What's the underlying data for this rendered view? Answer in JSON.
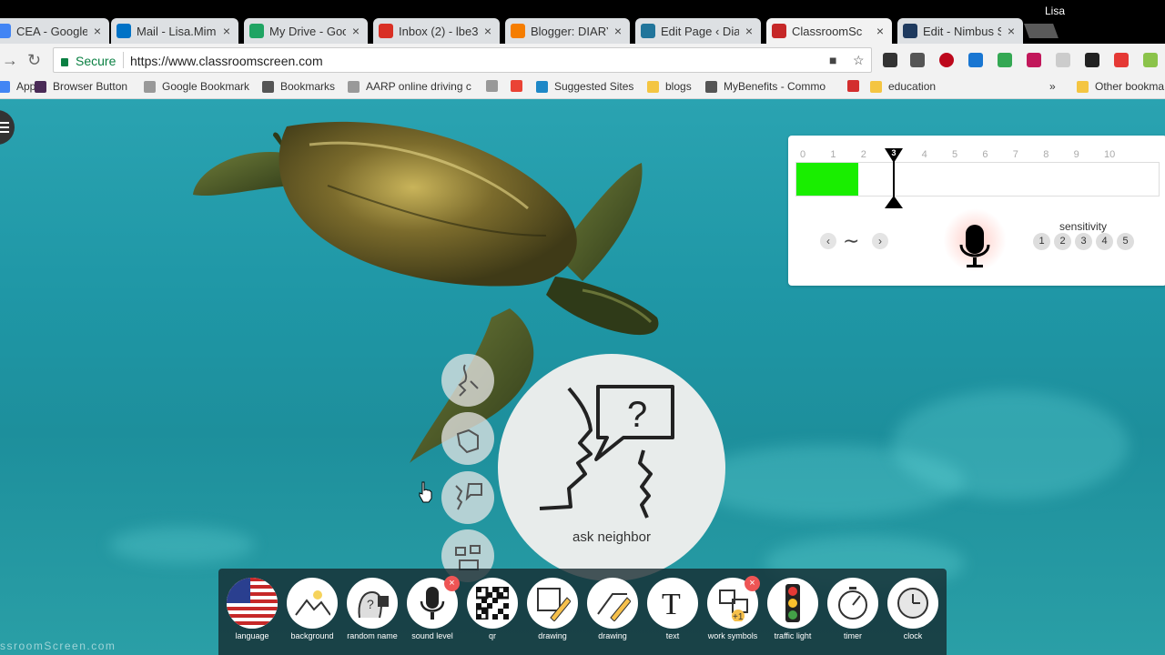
{
  "browser": {
    "user": "Lisa",
    "tabs": [
      {
        "title": "CEA - Google D",
        "icon": "google-docs-icon",
        "color": "#4285f4"
      },
      {
        "title": "Mail - Lisa.Mim",
        "icon": "outlook-icon",
        "color": "#0072c6"
      },
      {
        "title": "My Drive - Goo",
        "icon": "google-drive-icon",
        "color": "#1fa463"
      },
      {
        "title": "Inbox (2) - lbe3",
        "icon": "gmail-icon",
        "color": "#d93025"
      },
      {
        "title": "Blogger: DIARY",
        "icon": "blogger-icon",
        "color": "#f57d00"
      },
      {
        "title": "Edit Page ‹ Diar",
        "icon": "wordpress-icon",
        "color": "#21759b"
      },
      {
        "title": "ClassroomSc",
        "icon": "classroomscreen-icon",
        "color": "#c62828"
      },
      {
        "title": "Edit - Nimbus S",
        "icon": "nimbus-icon",
        "color": "#1e3a5f"
      }
    ],
    "secure_label": "Secure",
    "url": "https://www.classroomscreen.com",
    "bookmarks": [
      {
        "label": "Apps",
        "color": "#4285f4"
      },
      {
        "label": "Browser Button",
        "color": "#4a2b57"
      },
      {
        "label": "Google Bookmark",
        "color": "#999999"
      },
      {
        "label": "Bookmarks",
        "color": "#555555"
      },
      {
        "label": "AARP online driving c",
        "color": "#999999"
      },
      {
        "label": "",
        "color": "#999999"
      },
      {
        "label": "",
        "color": "#ea4335"
      },
      {
        "label": "Suggested Sites",
        "color": "#1e88c7"
      },
      {
        "label": "blogs",
        "color": "#f4c542"
      },
      {
        "label": "MyBenefits - Commo",
        "color": "#555555"
      },
      {
        "label": "",
        "color": "#d32f2f"
      },
      {
        "label": "education",
        "color": "#f4c542"
      },
      {
        "label": "Other bookma",
        "color": "#f4c542"
      }
    ],
    "more_bookmarks": "»"
  },
  "sound_widget": {
    "scale": [
      "0",
      "1",
      "2",
      "3",
      "4",
      "5",
      "6",
      "7",
      "8",
      "9",
      "10"
    ],
    "threshold": 3,
    "level_fraction": 0.17,
    "level_color": "#19ee00",
    "prev_label": "‹",
    "next_label": "›",
    "wave_label": "∼",
    "sensitivity_label": "sensitivity",
    "sensitivity_options": [
      "1",
      "2",
      "3",
      "4",
      "5"
    ]
  },
  "work_symbols": {
    "selected_label": "ask neighbor",
    "options": [
      "silence-icon",
      "hand-raise-icon",
      "ask-neighbor-icon",
      "work-together-icon"
    ]
  },
  "dock": [
    {
      "label": "language",
      "icon": "us-flag-icon"
    },
    {
      "label": "background",
      "icon": "landscape-icon"
    },
    {
      "label": "random name",
      "icon": "random-name-icon"
    },
    {
      "label": "sound level",
      "icon": "microphone-icon",
      "active": true
    },
    {
      "label": "qr",
      "icon": "qr-code-icon"
    },
    {
      "label": "drawing",
      "icon": "drawing-fullscreen-icon"
    },
    {
      "label": "drawing",
      "icon": "drawing-icon"
    },
    {
      "label": "text",
      "icon": "text-icon"
    },
    {
      "label": "work symbols",
      "icon": "work-symbols-icon",
      "active": true
    },
    {
      "label": "traffic light",
      "icon": "traffic-light-icon"
    },
    {
      "label": "timer",
      "icon": "timer-icon"
    },
    {
      "label": "clock",
      "icon": "clock-icon"
    }
  ],
  "watermark": "ssroomScreen.com"
}
